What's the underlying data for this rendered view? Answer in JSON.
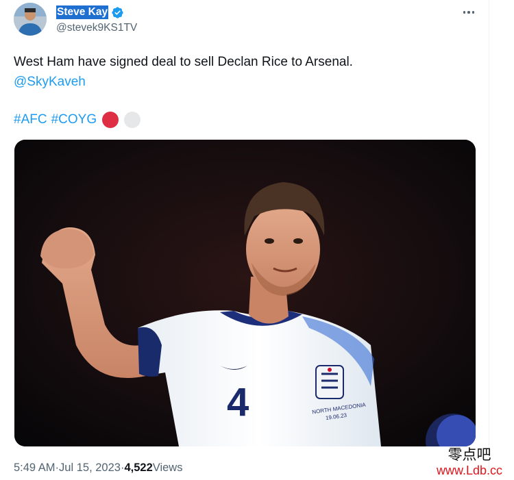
{
  "author": {
    "display_name": "Steve Kay",
    "handle": "@stevek9KS1TV",
    "verified": true
  },
  "tweet": {
    "text": "West Ham have signed deal to sell Declan Rice to Arsenal.",
    "mention": "@SkyKaveh",
    "hashtags": [
      "#AFC",
      "#COYG"
    ],
    "emoji_circles": [
      {
        "name": "red-circle",
        "color": "#dd2e44"
      },
      {
        "name": "white-circle",
        "color": "#e6e7e8"
      }
    ],
    "media": {
      "jersey_number": "4",
      "jersey_patch": "NORTH MACEDONIA",
      "jersey_patch_date": "19.06.23"
    }
  },
  "meta": {
    "time": "5:49 AM",
    "separator": " · ",
    "date": "Jul 15, 2023",
    "views_count": "4,522",
    "views_label": " Views"
  },
  "watermark": {
    "chinese_text": "零点吧",
    "url": "www.Ldb.cc"
  },
  "colors": {
    "link": "#1d9bf0",
    "text": "#0f1419",
    "secondary": "#536471",
    "selection": "#1f6fd1",
    "watermark_red": "#e0151b"
  }
}
